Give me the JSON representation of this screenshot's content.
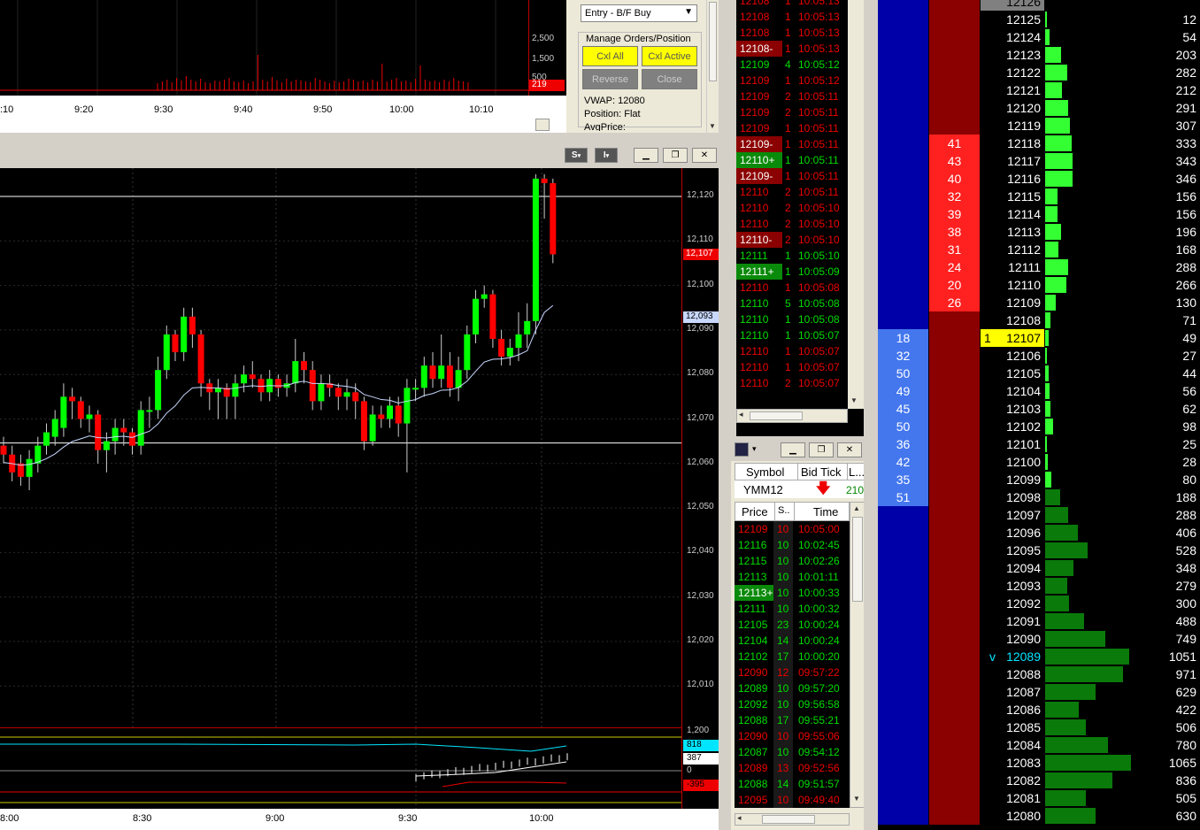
{
  "top_chart": {
    "axis_labels": [
      "2,500",
      "1,500",
      "500"
    ],
    "last_value": "219",
    "time_labels": [
      ":10",
      "9:20",
      "9:30",
      "9:40",
      "9:50",
      "10:00",
      "10:10"
    ]
  },
  "order_panel": {
    "entry_select": "Entry - B/F Buy",
    "group_label": "Manage Orders/Position",
    "buttons": {
      "cxl_all": "Cxl All",
      "cxl_active": "Cxl Active",
      "reverse": "Reverse",
      "close": "Close"
    },
    "vwap": "VWAP: 12080",
    "position": "Position: Flat",
    "avg_price": "AvgPrice:"
  },
  "main_chart": {
    "title_buttons": {
      "s": "S",
      "i": "I"
    },
    "price_labels": [
      "12,120",
      "12,110",
      "12,100",
      "12,090",
      "12,080",
      "12,070",
      "12,060",
      "12,050",
      "12,040",
      "12,030",
      "12,020",
      "12,010"
    ],
    "last_price_badge": "12,107",
    "ma_badge": "12,093",
    "indicator_labels": [
      "1,200",
      "818",
      "387",
      "0",
      "-395"
    ],
    "time_labels": [
      "8:00",
      "8:30",
      "9:00",
      "9:30",
      "10:00"
    ]
  },
  "time_sales": {
    "rows": [
      {
        "price": "12108",
        "size": "1",
        "time": "10:05:13",
        "color": "red",
        "hl": false
      },
      {
        "price": "12108",
        "size": "1",
        "time": "10:05:13",
        "color": "red",
        "hl": false
      },
      {
        "price": "12108",
        "size": "1",
        "time": "10:05:13",
        "color": "red",
        "hl": false
      },
      {
        "price": "12108-",
        "size": "1",
        "time": "10:05:13",
        "color": "red",
        "hl": true
      },
      {
        "price": "12109",
        "size": "4",
        "time": "10:05:12",
        "color": "green",
        "hl": false
      },
      {
        "price": "12109",
        "size": "1",
        "time": "10:05:12",
        "color": "red",
        "hl": false
      },
      {
        "price": "12109",
        "size": "2",
        "time": "10:05:11",
        "color": "red",
        "hl": false
      },
      {
        "price": "12109",
        "size": "2",
        "time": "10:05:11",
        "color": "red",
        "hl": false
      },
      {
        "price": "12109",
        "size": "1",
        "time": "10:05:11",
        "color": "red",
        "hl": false
      },
      {
        "price": "12109-",
        "size": "1",
        "time": "10:05:11",
        "color": "red",
        "hl": true
      },
      {
        "price": "12110+",
        "size": "1",
        "time": "10:05:11",
        "color": "green",
        "hl": true
      },
      {
        "price": "12109-",
        "size": "1",
        "time": "10:05:11",
        "color": "red",
        "hl": true
      },
      {
        "price": "12110",
        "size": "2",
        "time": "10:05:11",
        "color": "red",
        "hl": false
      },
      {
        "price": "12110",
        "size": "2",
        "time": "10:05:10",
        "color": "red",
        "hl": false
      },
      {
        "price": "12110",
        "size": "2",
        "time": "10:05:10",
        "color": "red",
        "hl": false
      },
      {
        "price": "12110-",
        "size": "2",
        "time": "10:05:10",
        "color": "red",
        "hl": true
      },
      {
        "price": "12111",
        "size": "1",
        "time": "10:05:10",
        "color": "green",
        "hl": false
      },
      {
        "price": "12111+",
        "size": "1",
        "time": "10:05:09",
        "color": "green",
        "hl": true
      },
      {
        "price": "12110",
        "size": "1",
        "time": "10:05:08",
        "color": "red",
        "hl": false
      },
      {
        "price": "12110",
        "size": "5",
        "time": "10:05:08",
        "color": "green",
        "hl": false
      },
      {
        "price": "12110",
        "size": "1",
        "time": "10:05:08",
        "color": "green",
        "hl": false
      },
      {
        "price": "12110",
        "size": "1",
        "time": "10:05:07",
        "color": "green",
        "hl": false
      },
      {
        "price": "12110",
        "size": "1",
        "time": "10:05:07",
        "color": "red",
        "hl": false
      },
      {
        "price": "12110",
        "size": "1",
        "time": "10:05:07",
        "color": "red",
        "hl": false
      },
      {
        "price": "12110",
        "size": "2",
        "time": "10:05:07",
        "color": "red",
        "hl": false
      }
    ]
  },
  "quote": {
    "headers": [
      "Symbol",
      "Bid Tick",
      "L..."
    ],
    "symbol": "YMM12",
    "last": "210",
    "list_headers": [
      "Price",
      "S..",
      "Time"
    ],
    "rows": [
      {
        "price": "12109",
        "size": "10",
        "time": "10:05:00",
        "color": "red",
        "hl": false
      },
      {
        "price": "12116",
        "size": "10",
        "time": "10:02:45",
        "color": "green",
        "hl": false
      },
      {
        "price": "12115",
        "size": "10",
        "time": "10:02:26",
        "color": "green",
        "hl": false
      },
      {
        "price": "12113",
        "size": "10",
        "time": "10:01:11",
        "color": "green",
        "hl": false
      },
      {
        "price": "12113+",
        "size": "10",
        "time": "10:00:33",
        "color": "green",
        "hl": true
      },
      {
        "price": "12111",
        "size": "10",
        "time": "10:00:32",
        "color": "green",
        "hl": false
      },
      {
        "price": "12105",
        "size": "23",
        "time": "10:00:24",
        "color": "green",
        "hl": false
      },
      {
        "price": "12104",
        "size": "14",
        "time": "10:00:24",
        "color": "green",
        "hl": false
      },
      {
        "price": "12102",
        "size": "17",
        "time": "10:00:20",
        "color": "green",
        "hl": false
      },
      {
        "price": "12090",
        "size": "12",
        "time": "09:57:22",
        "color": "red",
        "hl": false
      },
      {
        "price": "12089",
        "size": "10",
        "time": "09:57:20",
        "color": "green",
        "hl": false
      },
      {
        "price": "12092",
        "size": "10",
        "time": "09:56:58",
        "color": "green",
        "hl": false
      },
      {
        "price": "12088",
        "size": "17",
        "time": "09:55:21",
        "color": "green",
        "hl": false
      },
      {
        "price": "12090",
        "size": "10",
        "time": "09:55:06",
        "color": "red",
        "hl": false
      },
      {
        "price": "12087",
        "size": "10",
        "time": "09:54:12",
        "color": "green",
        "hl": false
      },
      {
        "price": "12089",
        "size": "13",
        "time": "09:52:56",
        "color": "red",
        "hl": false
      },
      {
        "price": "12088",
        "size": "14",
        "time": "09:51:57",
        "color": "green",
        "hl": false
      },
      {
        "price": "12095",
        "size": "10",
        "time": "09:49:40",
        "color": "red",
        "hl": false
      }
    ]
  },
  "ladder": {
    "rows": [
      {
        "bid": "",
        "ask": "",
        "price": "12126",
        "vol": "",
        "bar": 0,
        "dark": false
      },
      {
        "bid": "",
        "ask": "",
        "price": "12125",
        "vol": "12",
        "bar": 2,
        "dark": false
      },
      {
        "bid": "",
        "ask": "",
        "price": "12124",
        "vol": "54",
        "bar": 5,
        "dark": false
      },
      {
        "bid": "",
        "ask": "",
        "price": "12123",
        "vol": "203",
        "bar": 18,
        "dark": false
      },
      {
        "bid": "",
        "ask": "",
        "price": "12122",
        "vol": "282",
        "bar": 25,
        "dark": false
      },
      {
        "bid": "",
        "ask": "",
        "price": "12121",
        "vol": "212",
        "bar": 19,
        "dark": false
      },
      {
        "bid": "",
        "ask": "",
        "price": "12120",
        "vol": "291",
        "bar": 26,
        "dark": false
      },
      {
        "bid": "",
        "ask": "",
        "price": "12119",
        "vol": "307",
        "bar": 28,
        "dark": false
      },
      {
        "bid": "",
        "ask": "41",
        "price": "12118",
        "vol": "333",
        "bar": 30,
        "dark": false
      },
      {
        "bid": "",
        "ask": "43",
        "price": "12117",
        "vol": "343",
        "bar": 31,
        "dark": false
      },
      {
        "bid": "",
        "ask": "40",
        "price": "12116",
        "vol": "346",
        "bar": 31,
        "dark": false
      },
      {
        "bid": "",
        "ask": "32",
        "price": "12115",
        "vol": "156",
        "bar": 14,
        "dark": false
      },
      {
        "bid": "",
        "ask": "39",
        "price": "12114",
        "vol": "156",
        "bar": 14,
        "dark": false
      },
      {
        "bid": "",
        "ask": "38",
        "price": "12113",
        "vol": "196",
        "bar": 18,
        "dark": false
      },
      {
        "bid": "",
        "ask": "31",
        "price": "12112",
        "vol": "168",
        "bar": 15,
        "dark": false
      },
      {
        "bid": "",
        "ask": "24",
        "price": "12111",
        "vol": "288",
        "bar": 26,
        "dark": false
      },
      {
        "bid": "",
        "ask": "20",
        "price": "12110",
        "vol": "266",
        "bar": 24,
        "dark": false
      },
      {
        "bid": "",
        "ask": "26",
        "price": "12109",
        "vol": "130",
        "bar": 12,
        "dark": false
      },
      {
        "bid": "",
        "ask": "",
        "price": "12108",
        "vol": "71",
        "bar": 6,
        "dark": false
      },
      {
        "bid": "18",
        "ask": "",
        "price": "12107",
        "vol": "49",
        "bar": 4,
        "dark": false,
        "last": "1"
      },
      {
        "bid": "32",
        "ask": "",
        "price": "12106",
        "vol": "27",
        "bar": 2,
        "dark": false
      },
      {
        "bid": "50",
        "ask": "",
        "price": "12105",
        "vol": "44",
        "bar": 4,
        "dark": false
      },
      {
        "bid": "49",
        "ask": "",
        "price": "12104",
        "vol": "56",
        "bar": 5,
        "dark": false
      },
      {
        "bid": "45",
        "ask": "",
        "price": "12103",
        "vol": "62",
        "bar": 6,
        "dark": false
      },
      {
        "bid": "50",
        "ask": "",
        "price": "12102",
        "vol": "98",
        "bar": 9,
        "dark": false
      },
      {
        "bid": "36",
        "ask": "",
        "price": "12101",
        "vol": "25",
        "bar": 2,
        "dark": false
      },
      {
        "bid": "42",
        "ask": "",
        "price": "12100",
        "vol": "28",
        "bar": 3,
        "dark": false
      },
      {
        "bid": "35",
        "ask": "",
        "price": "12099",
        "vol": "80",
        "bar": 7,
        "dark": false
      },
      {
        "bid": "51",
        "ask": "",
        "price": "12098",
        "vol": "188",
        "bar": 17,
        "dark": true
      },
      {
        "bid": "",
        "ask": "",
        "price": "12097",
        "vol": "288",
        "bar": 26,
        "dark": true
      },
      {
        "bid": "",
        "ask": "",
        "price": "12096",
        "vol": "406",
        "bar": 37,
        "dark": true
      },
      {
        "bid": "",
        "ask": "",
        "price": "12095",
        "vol": "528",
        "bar": 48,
        "dark": true
      },
      {
        "bid": "",
        "ask": "",
        "price": "12094",
        "vol": "348",
        "bar": 32,
        "dark": true
      },
      {
        "bid": "",
        "ask": "",
        "price": "12093",
        "vol": "279",
        "bar": 25,
        "dark": true
      },
      {
        "bid": "",
        "ask": "",
        "price": "12092",
        "vol": "300",
        "bar": 27,
        "dark": true
      },
      {
        "bid": "",
        "ask": "",
        "price": "12091",
        "vol": "488",
        "bar": 44,
        "dark": true
      },
      {
        "bid": "",
        "ask": "",
        "price": "12090",
        "vol": "749",
        "bar": 68,
        "dark": true
      },
      {
        "bid": "",
        "ask": "",
        "price": "12089",
        "vol": "1051",
        "bar": 95,
        "dark": true,
        "vwap": "v"
      },
      {
        "bid": "",
        "ask": "",
        "price": "12088",
        "vol": "971",
        "bar": 88,
        "dark": true
      },
      {
        "bid": "",
        "ask": "",
        "price": "12087",
        "vol": "629",
        "bar": 57,
        "dark": true
      },
      {
        "bid": "",
        "ask": "",
        "price": "12086",
        "vol": "422",
        "bar": 38,
        "dark": true
      },
      {
        "bid": "",
        "ask": "",
        "price": "12085",
        "vol": "506",
        "bar": 46,
        "dark": true
      },
      {
        "bid": "",
        "ask": "",
        "price": "12084",
        "vol": "780",
        "bar": 71,
        "dark": true
      },
      {
        "bid": "",
        "ask": "",
        "price": "12083",
        "vol": "1065",
        "bar": 97,
        "dark": true
      },
      {
        "bid": "",
        "ask": "",
        "price": "12082",
        "vol": "836",
        "bar": 76,
        "dark": true
      },
      {
        "bid": "",
        "ask": "",
        "price": "12081",
        "vol": "505",
        "bar": 46,
        "dark": true
      },
      {
        "bid": "",
        "ask": "",
        "price": "12080",
        "vol": "630",
        "bar": 57,
        "dark": true
      }
    ]
  },
  "colors": {
    "up": "#00ff00",
    "down": "#ff0000",
    "bid": "#0000a8",
    "ask": "#8b0000"
  }
}
